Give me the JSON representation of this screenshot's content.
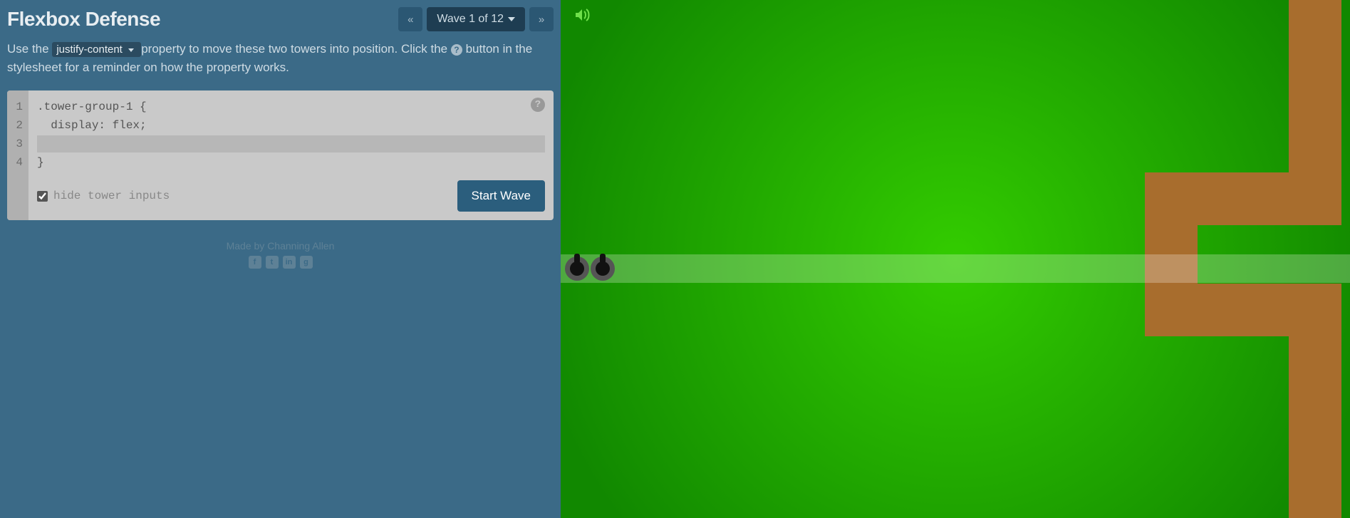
{
  "header": {
    "title": "Flexbox Defense",
    "wave_label": "Wave 1 of 12",
    "prev_icon": "«",
    "next_icon": "»"
  },
  "instructions": {
    "part1": "Use the ",
    "property_name": "justify-content",
    "part2": " property to move these two towers into position. Click the ",
    "help_char": "?",
    "part3": " button in the stylesheet for a reminder on how the property works."
  },
  "editor": {
    "line_numbers": [
      "1",
      "2",
      "3",
      "4"
    ],
    "lines": {
      "selector": ".tower-group-1 {",
      "declaration": "  display: flex;",
      "input_value": "",
      "close": "}"
    },
    "help_char": "?",
    "hide_inputs_label": "hide tower inputs",
    "hide_inputs_checked": true,
    "start_wave_label": "Start Wave"
  },
  "credits": {
    "text": "Made by Channing Allen",
    "social": [
      "facebook",
      "twitter",
      "linkedin",
      "github"
    ]
  },
  "game": {
    "sound_on": true,
    "towers_count": 2
  }
}
